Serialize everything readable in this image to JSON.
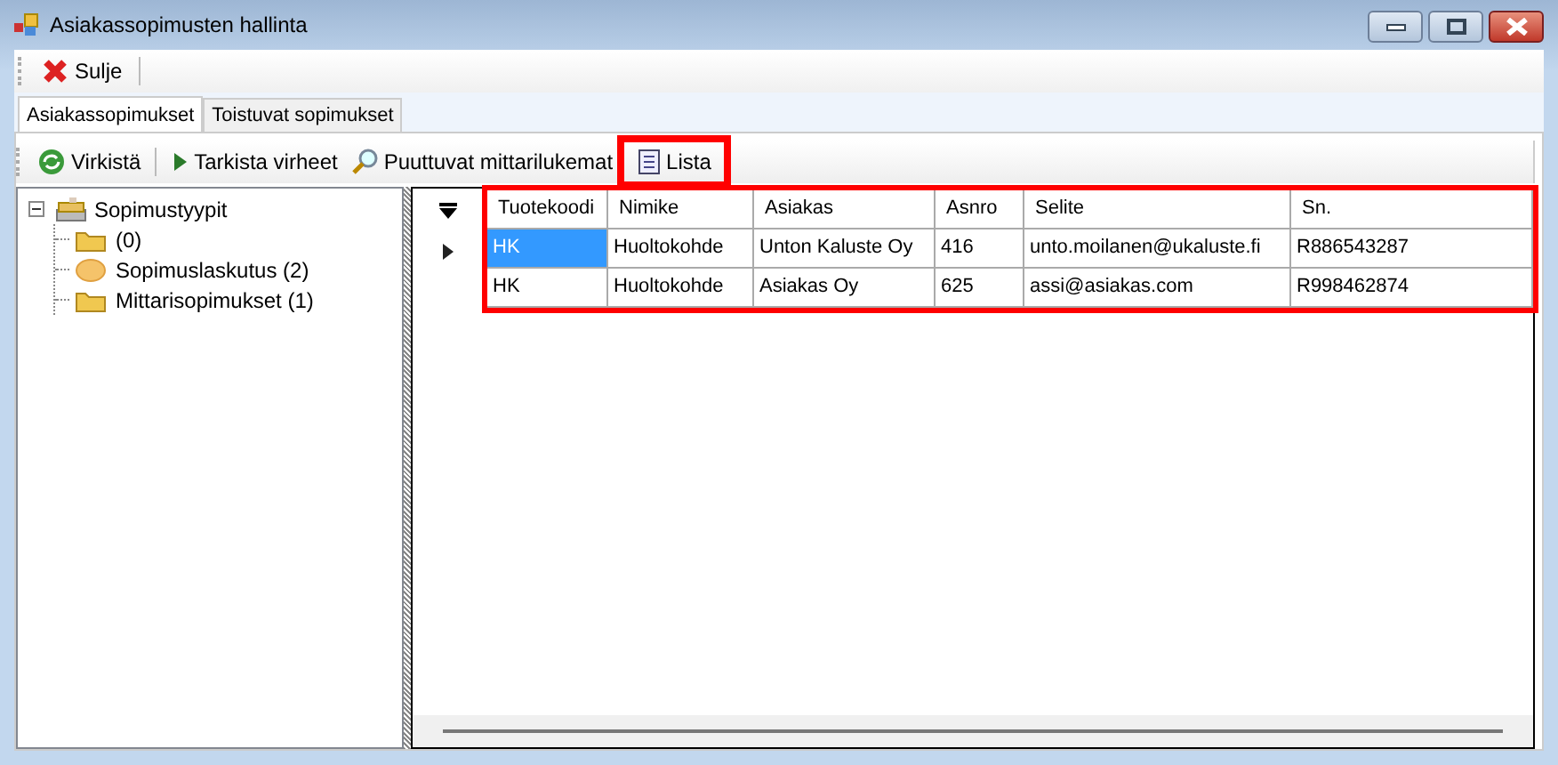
{
  "window": {
    "title": "Asiakassopimusten hallinta"
  },
  "toolbar": [
    {
      "label": "Sulje",
      "kind": "close"
    }
  ],
  "tabs": [
    {
      "label": "Asiakassopimukset",
      "selected": true
    },
    {
      "label": "Toistuvat sopimukset",
      "selected": false
    }
  ],
  "actions": [
    {
      "label": "Virkistä",
      "kind": "refresh",
      "highlighted": false
    },
    {
      "label": "Tarkista virheet",
      "kind": "play",
      "highlighted": false
    },
    {
      "label": "Puuttuvat mittarilukemat",
      "kind": "search",
      "highlighted": false
    },
    {
      "label": "Lista",
      "kind": "document",
      "highlighted": true
    }
  ],
  "tree": {
    "label": "Sopimustyypit",
    "expanded": true,
    "children": [
      {
        "label": "(0)",
        "kind": "folder"
      },
      {
        "label": "Sopimuslaskutus (2)",
        "kind": "ellipse"
      },
      {
        "label": "Mittarisopimukset (1)",
        "kind": "folder"
      }
    ]
  },
  "table": {
    "highlighted": true,
    "columns": [
      "Tuotekoodi",
      "Nimike",
      "Asiakas",
      "Asnro",
      "Selite",
      "Sn."
    ],
    "rows": [
      {
        "selected": true,
        "cells": [
          "HK",
          "Huoltokohde",
          "Unton Kaluste Oy",
          "416",
          "unto.moilanen@ukaluste.fi",
          "R886543287"
        ]
      },
      {
        "selected": false,
        "cells": [
          "HK",
          "Huoltokohde",
          "Asiakas Oy",
          "625",
          "assi@asiakas.com",
          "R998462874"
        ]
      }
    ]
  }
}
